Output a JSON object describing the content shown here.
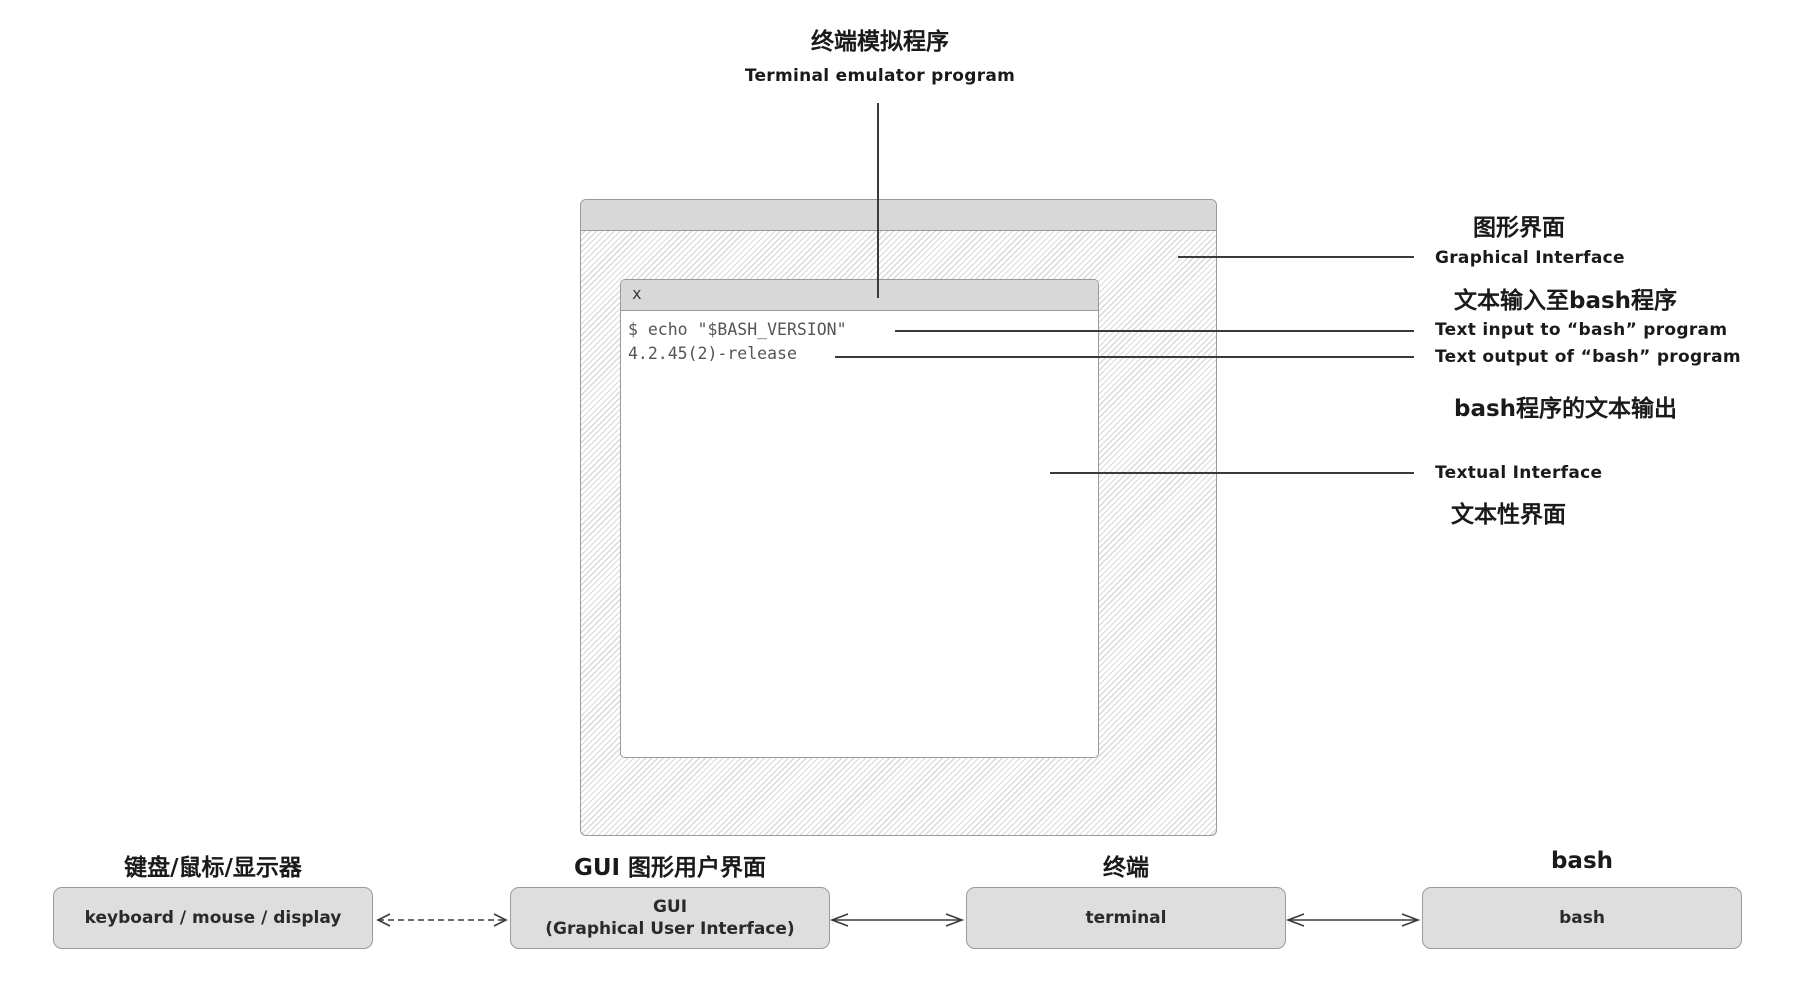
{
  "top_label": {
    "cn": "终端模拟程序",
    "en": "Terminal emulator program"
  },
  "right_labels": {
    "graphical_cn": "图形界面",
    "graphical_en": "Graphical Interface",
    "input_cn": "文本输入至bash程序",
    "input_en": "Text input to “bash” program",
    "output_en": "Text output of “bash” program",
    "output_cn": "bash程序的文本输出",
    "textual_en": "Textual Interface",
    "textual_cn": "文本性界面"
  },
  "terminal": {
    "close_label": "x",
    "lines": [
      "$ echo \"$BASH_VERSION\"",
      "4.2.45(2)-release"
    ]
  },
  "boxes": [
    {
      "title": "键盘/鼠标/显示器",
      "label": "keyboard / mouse / display"
    },
    {
      "title": "GUI 图形用户界面",
      "label": "GUI\n(Graphical User Interface)"
    },
    {
      "title": "终端",
      "label": "terminal"
    },
    {
      "title": "bash",
      "label": "bash"
    }
  ]
}
